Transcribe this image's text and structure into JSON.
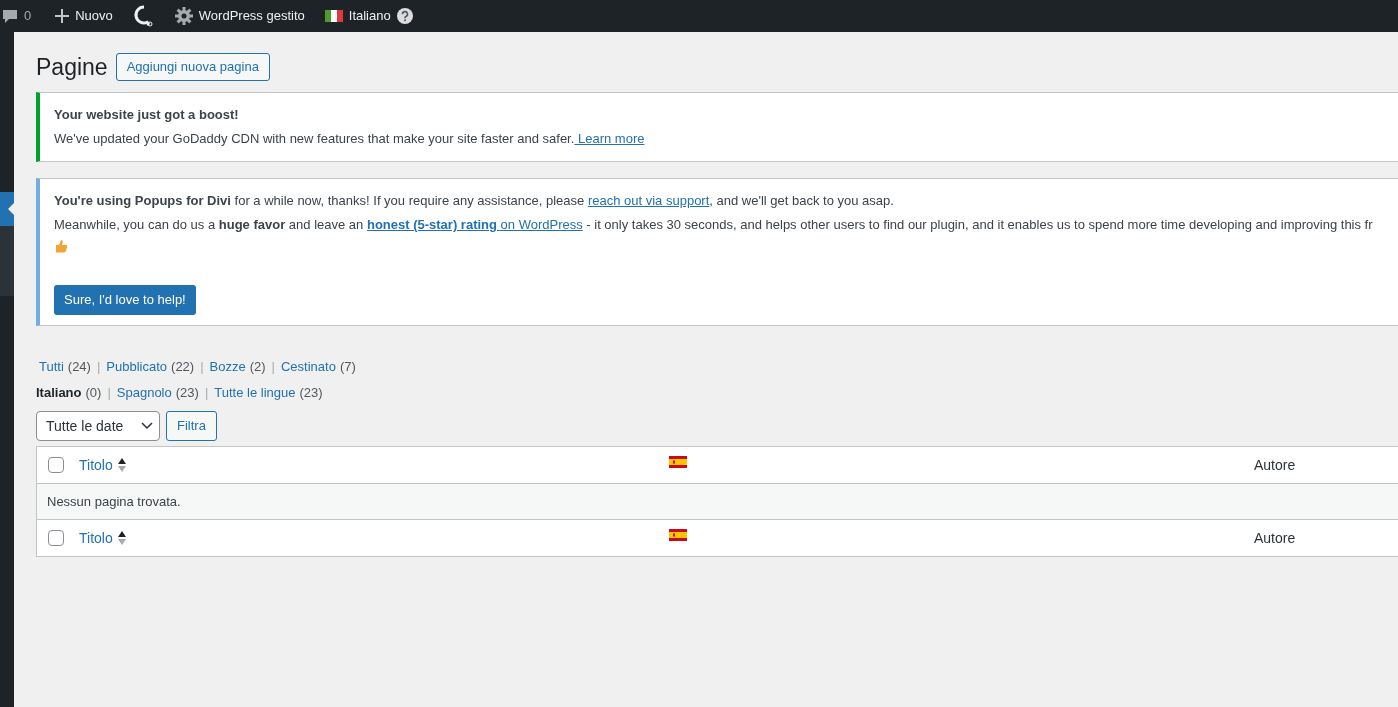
{
  "admin_bar": [
    {
      "kind": "comments",
      "label": "0"
    },
    {
      "kind": "new",
      "label": "Nuovo"
    },
    {
      "kind": "logo"
    },
    {
      "kind": "settings",
      "label": "WordPress gestito"
    },
    {
      "kind": "language",
      "label": "Italiano"
    }
  ],
  "page": {
    "title": "Pagine",
    "add_button": "Aggiungi nuova pagina"
  },
  "notices": [
    {
      "kind": "success",
      "paragraphs": [
        [
          {
            "kind": "text",
            "text": "**Your website just got a boost!**"
          }
        ],
        [
          {
            "kind": "text",
            "text": "We've updated your GoDaddy CDN with new features that make your site faster and safer."
          },
          {
            "kind": "link",
            "text": " Learn more"
          }
        ]
      ]
    },
    {
      "kind": "info",
      "paragraphs": [
        [
          {
            "kind": "text",
            "text": "**You're using Popups for Divi** for a while now, thanks! If you require any assistance, please "
          },
          {
            "kind": "link",
            "text": "reach out via support"
          },
          {
            "kind": "text",
            "text": ", and we'll get back to you asap."
          }
        ],
        [
          {
            "kind": "text",
            "text": "Meanwhile, you can do us a **huge favor** and leave an "
          },
          {
            "kind": "link",
            "text": "**honest (5-star) rating** on WordPress"
          },
          {
            "kind": "text",
            "text": " - it only takes 30 seconds, and helps other users to find our plugin, and it enables us to spend more time developing and improving this fr"
          }
        ]
      ],
      "emoji": true,
      "button": "Sure, I'd love to help!"
    }
  ],
  "status_links": [
    {
      "label": "Tutti",
      "count": "(24)",
      "selected": false
    },
    {
      "separator": "|",
      "label": "Pubblicato",
      "count": "(22)",
      "selected": false
    },
    {
      "separator": "|",
      "label": "Bozze",
      "count": "(2)",
      "selected": false
    },
    {
      "separator": "|",
      "label": "Cestinato",
      "count": "(7)",
      "selected": false
    }
  ],
  "language_links": [
    {
      "label": "Italiano",
      "count": "(0)",
      "selected": true
    },
    {
      "separator": "|",
      "label": "Spagnolo",
      "count": "(23)",
      "selected": false
    },
    {
      "separator": "|",
      "label": "Tutte le lingue",
      "count": "(23)",
      "selected": false
    }
  ],
  "filter": {
    "date_select": "Tutte le date",
    "button": "Filtra"
  },
  "table": {
    "header": {
      "checked": false,
      "title": "Titolo",
      "author": "Autore"
    },
    "empty_message": "Nessun pagina trovata.",
    "footer": {
      "checked": false,
      "title": "Titolo",
      "author": "Autore"
    }
  }
}
